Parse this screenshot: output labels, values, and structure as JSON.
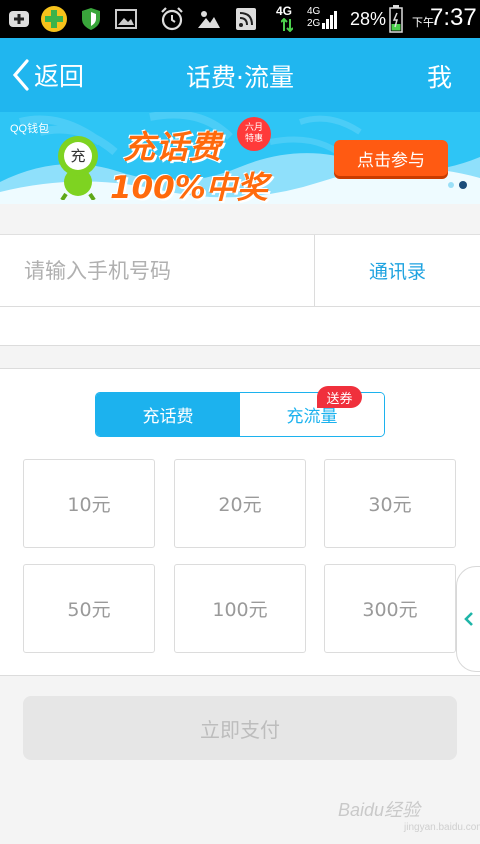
{
  "status_bar": {
    "network": "4G",
    "network_2": "4G",
    "network_3": "2G",
    "battery": "28%",
    "ampm": "下午",
    "time": "7:37"
  },
  "header": {
    "back_label": "返回",
    "title": "话费·流量",
    "me_label": "我"
  },
  "banner": {
    "logo": "QQ钱包",
    "icon_char": "充",
    "headline_1": "充话费",
    "headline_2": "100%中奖",
    "badge_line1": "六月",
    "badge_line2": "特惠",
    "cta_label": "点击参与",
    "bg_color": "#2ec5f5",
    "cta_color": "#ff5a12"
  },
  "phone": {
    "placeholder": "请输入手机号码",
    "value": "",
    "contacts_label": "通讯录"
  },
  "tabs": {
    "recharge_label": "充话费",
    "data_label": "充流量",
    "coupon_tag": "送券",
    "active": "充话费"
  },
  "amounts": [
    "10元",
    "20元",
    "30元",
    "50元",
    "100元",
    "300元"
  ],
  "pay": {
    "label": "立即支付",
    "enabled": false
  },
  "watermark": {
    "text": "Baidu经验",
    "sub": "jingyan.baidu.com"
  },
  "colors": {
    "accent": "#20b6ef",
    "link": "#1fa3e0",
    "coupon": "#f0303c"
  }
}
